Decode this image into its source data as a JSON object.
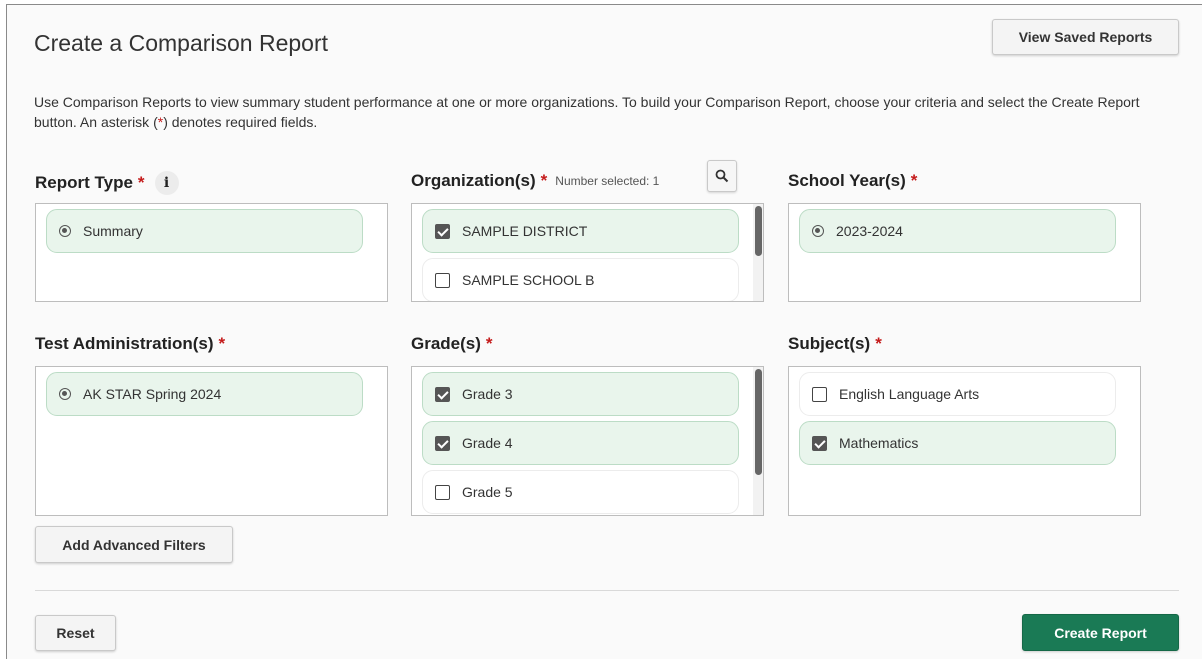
{
  "header": {
    "title": "Create a Comparison Report",
    "view_saved_label": "View Saved Reports"
  },
  "description": {
    "before_star": "Use Comparison Reports to view summary student performance at one or more organizations. To build your Comparison Report, choose your criteria and select the Create Report button. An asterisk (",
    "star": "*",
    "after_star": ") denotes required fields."
  },
  "report_type": {
    "label": "Report Type",
    "required_mark": "*",
    "info_glyph": "i",
    "options": [
      {
        "label": "Summary",
        "selected": true
      }
    ]
  },
  "organizations": {
    "label": "Organization(s)",
    "required_mark": "*",
    "number_selected": "Number selected: 1",
    "options": [
      {
        "label": "SAMPLE DISTRICT",
        "checked": true
      },
      {
        "label": "SAMPLE SCHOOL B",
        "checked": false
      }
    ]
  },
  "school_year": {
    "label": "School Year(s)",
    "required_mark": "*",
    "options": [
      {
        "label": "2023-2024",
        "selected": true
      }
    ]
  },
  "test_admin": {
    "label": "Test Administration(s)",
    "required_mark": "*",
    "options": [
      {
        "label": "AK STAR Spring 2024",
        "selected": true
      }
    ]
  },
  "grades": {
    "label": "Grade(s)",
    "required_mark": "*",
    "options": [
      {
        "label": "Grade 3",
        "checked": true
      },
      {
        "label": "Grade 4",
        "checked": true
      },
      {
        "label": "Grade 5",
        "checked": false
      }
    ]
  },
  "subjects": {
    "label": "Subject(s)",
    "required_mark": "*",
    "options": [
      {
        "label": "English Language Arts",
        "checked": false
      },
      {
        "label": "Mathematics",
        "checked": true
      }
    ]
  },
  "buttons": {
    "advanced_filters": "Add Advanced Filters",
    "reset": "Reset",
    "create_report": "Create Report"
  },
  "colors": {
    "primary": "#1a7a55",
    "required": "#c41a1a",
    "selected_bg": "#e9f5ec"
  }
}
